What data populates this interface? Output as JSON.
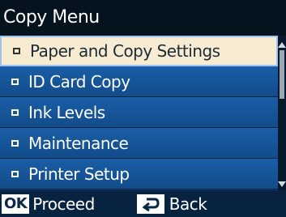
{
  "header": {
    "title": "Copy Menu"
  },
  "menu": {
    "items": [
      {
        "label": "Paper and Copy Settings",
        "selected": true
      },
      {
        "label": "ID Card Copy",
        "selected": false
      },
      {
        "label": "Ink Levels",
        "selected": false
      },
      {
        "label": "Maintenance",
        "selected": false
      },
      {
        "label": "Printer Setup",
        "selected": false
      }
    ]
  },
  "footer": {
    "ok_badge": "OK",
    "proceed_label": "Proceed",
    "back_label": "Back",
    "back_icon": "back-arrow-icon"
  },
  "colors": {
    "title_bar_bg": "#05131f",
    "menu_item_bg": "#1a5ea6",
    "selected_item_bg": "#f7ecd2",
    "footer_bg": "#08233f"
  }
}
